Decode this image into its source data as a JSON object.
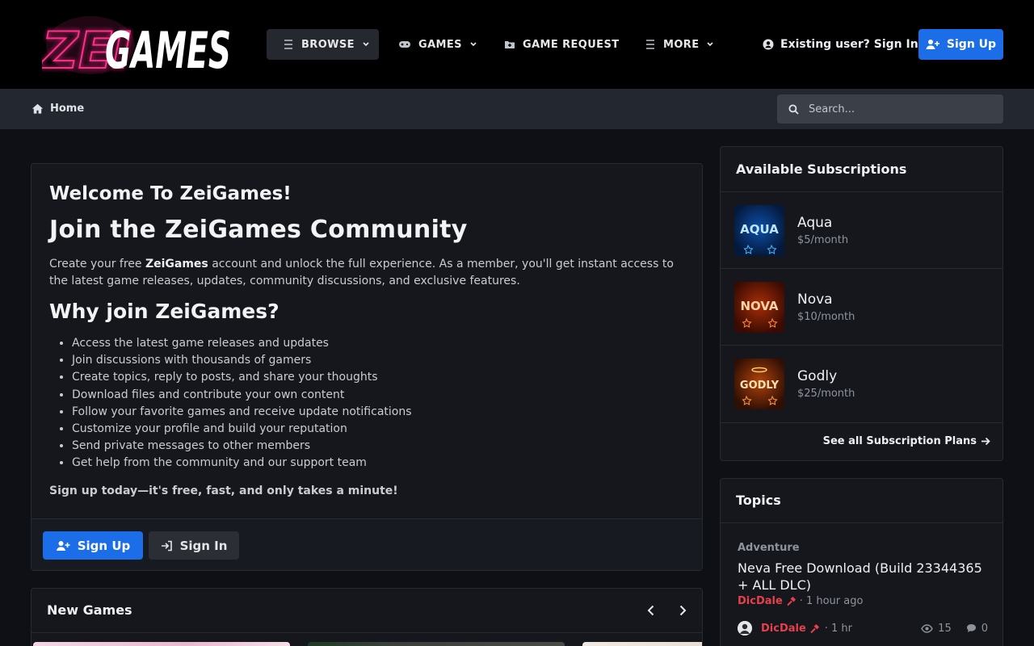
{
  "brand": {
    "logo_text_left": "ZEI",
    "logo_text_right": "GAMES"
  },
  "nav": {
    "browse": "BROWSE",
    "games": "GAMES",
    "game_request": "GAME REQUEST",
    "more": "MORE",
    "signin": "Existing user? Sign In",
    "signup": "Sign Up"
  },
  "breadcrumb": {
    "home": "Home"
  },
  "search": {
    "placeholder": "Search..."
  },
  "welcome": {
    "title": "Welcome To ZeiGames!",
    "heading": "Join the ZeiGames Community",
    "intro_before": "Create your free ",
    "intro_brand": "ZeiGames",
    "intro_after": " account and unlock the full experience. As a member, you'll get instant access to the latest game releases, updates, community discussions, and exclusive features.",
    "why": "Why join ZeiGames?",
    "benefits": [
      "Access the latest game releases and updates",
      "Join discussions with thousands of gamers",
      "Create topics, reply to posts, and share your thoughts",
      "Download files and contribute your own content",
      "Follow your favorite games and receive update notifications",
      "Customize your profile and build your reputation",
      "Send private messages to other members",
      "Get help from the community and our support team"
    ],
    "cta": "Sign up today—it's free, fast, and only takes a minute!",
    "signup": "Sign Up",
    "signin": "Sign In"
  },
  "new_games": {
    "title": "New Games"
  },
  "subscriptions": {
    "title": "Available Subscriptions",
    "plans": [
      {
        "name": "Aqua",
        "price": "$5/month",
        "badge": "AQUA",
        "color": "#1f8fff"
      },
      {
        "name": "Nova",
        "price": "$10/month",
        "badge": "NOVA",
        "color": "#ff6a1a"
      },
      {
        "name": "Godly",
        "price": "$25/month",
        "badge": "GODLY",
        "color": "#ff8a1c"
      }
    ],
    "see_all": "See all Subscription Plans"
  },
  "topics": {
    "title": "Topics",
    "items": [
      {
        "category": "Adventure",
        "title": "Neva Free Download (Build 23344365 + ALL DLC)",
        "author": "DicDale",
        "posted": "1 hour ago",
        "last_author": "DicDale",
        "last_time": "1 hr",
        "views": "15",
        "replies": "0"
      }
    ]
  },
  "colors": {
    "accent": "#1c6ee8",
    "author": "#e6404a",
    "logo_pink": "#ff2d8a"
  }
}
